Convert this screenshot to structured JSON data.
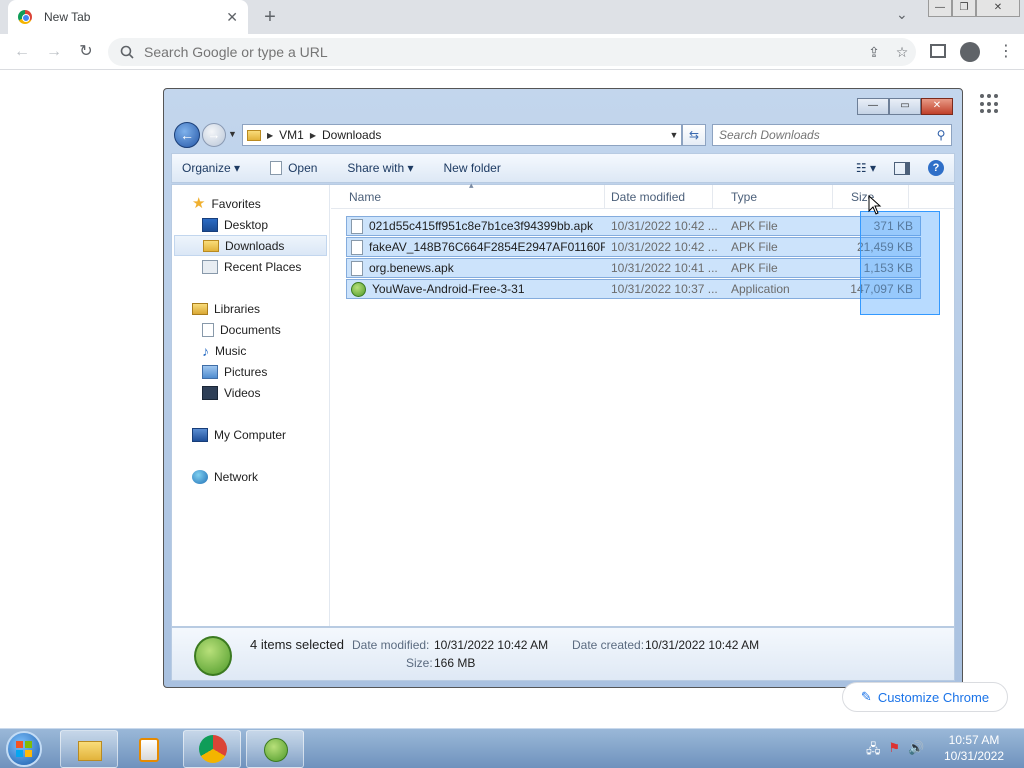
{
  "browser": {
    "tab_title": "New Tab",
    "tab_close": "✕",
    "new_tab": "+",
    "tab_dropdown": "⌄",
    "window_minimize": "—",
    "window_restore": "❐",
    "window_close": "✕",
    "back": "←",
    "forward": "→",
    "reload": "↻",
    "omnibox_placeholder": "Search Google or type a URL",
    "customize_label": "Customize Chrome"
  },
  "explorer": {
    "breadcrumb": [
      "VM1",
      "Downloads"
    ],
    "search_placeholder": "Search Downloads",
    "commands": {
      "organize": "Organize ▾",
      "open": "Open",
      "share_with": "Share with ▾",
      "new_folder": "New folder"
    },
    "nav": {
      "favorites": "Favorites",
      "desktop": "Desktop",
      "downloads": "Downloads",
      "recent_places": "Recent Places",
      "libraries": "Libraries",
      "documents": "Documents",
      "music": "Music",
      "pictures": "Pictures",
      "videos": "Videos",
      "my_computer": "My Computer",
      "network": "Network"
    },
    "columns": [
      "Name",
      "Date modified",
      "Type",
      "Size"
    ],
    "files": [
      {
        "name": "021d55c415ff951c8e7b1ce3f94399bb.apk",
        "date": "10/31/2022 10:42 ...",
        "type": "APK File",
        "size": "371 KB",
        "icon": "file-icon"
      },
      {
        "name": "fakeAV_148B76C664F2854E2947AF01160F...",
        "date": "10/31/2022 10:42 ...",
        "type": "APK File",
        "size": "21,459 KB",
        "icon": "file-icon"
      },
      {
        "name": "org.benews.apk",
        "date": "10/31/2022 10:41 ...",
        "type": "APK File",
        "size": "1,153 KB",
        "icon": "file-icon"
      },
      {
        "name": "YouWave-Android-Free-3-31",
        "date": "10/31/2022 10:37 ...",
        "type": "Application",
        "size": "147,097 KB",
        "icon": "android-app-icon"
      }
    ],
    "details": {
      "selected": "4 items selected",
      "date_modified_label": "Date modified:",
      "date_modified": "10/31/2022 10:42 AM",
      "date_created_label": "Date created:",
      "date_created": "10/31/2022 10:42 AM",
      "size_label": "Size:",
      "size": "166 MB"
    }
  },
  "taskbar": {
    "time": "10:57 AM",
    "date": "10/31/2022"
  },
  "colors": {
    "selection": "#cce3fb",
    "chrome_accent": "#1a73e8"
  }
}
